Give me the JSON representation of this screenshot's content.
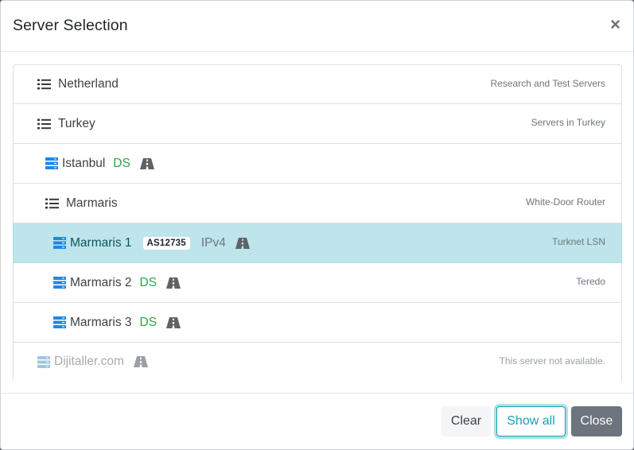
{
  "header": {
    "title": "Server Selection",
    "close_symbol": "×"
  },
  "colors": {
    "server_icon": "#1e88e5",
    "server_icon_disabled": "#9ec3e6",
    "list_icon": "#343a40",
    "road_icon": "#5f6368",
    "ds_text": "#28a745",
    "active_row": "#bee5eb",
    "info_button": "#17a2b8",
    "secondary_button": "#6c757d"
  },
  "servers": [
    {
      "type": "group",
      "icon": "list-icon",
      "name": "Netherland",
      "description": "Research and Test Servers"
    },
    {
      "type": "group",
      "icon": "list-icon",
      "name": "Turkey",
      "description": "Servers in Turkey"
    },
    {
      "type": "server",
      "icon": "server-icon",
      "name": "Istanbul",
      "tag": "DS",
      "road_icon": "road-icon"
    },
    {
      "type": "group",
      "icon": "list-icon",
      "name": "Marmaris",
      "description": "White-Door Router"
    },
    {
      "type": "server",
      "icon": "server-icon",
      "name": "Marmaris 1",
      "badge": "AS12735",
      "protocol": "IPv4",
      "road_icon": "road-icon",
      "description": "Turknet LSN",
      "active": true
    },
    {
      "type": "server",
      "icon": "server-icon",
      "name": "Marmaris 2",
      "tag": "DS",
      "road_icon": "road-icon",
      "description": "Teredo"
    },
    {
      "type": "server",
      "icon": "server-icon",
      "name": "Marmaris 3",
      "tag": "DS",
      "road_icon": "road-icon"
    },
    {
      "type": "server",
      "icon": "server-icon",
      "name": "Dijitaller.com",
      "road_icon": "road-icon",
      "description": "This server not available.",
      "disabled": true
    }
  ],
  "footer": {
    "clear_label": "Clear",
    "show_all_label": "Show all",
    "close_label": "Close"
  }
}
